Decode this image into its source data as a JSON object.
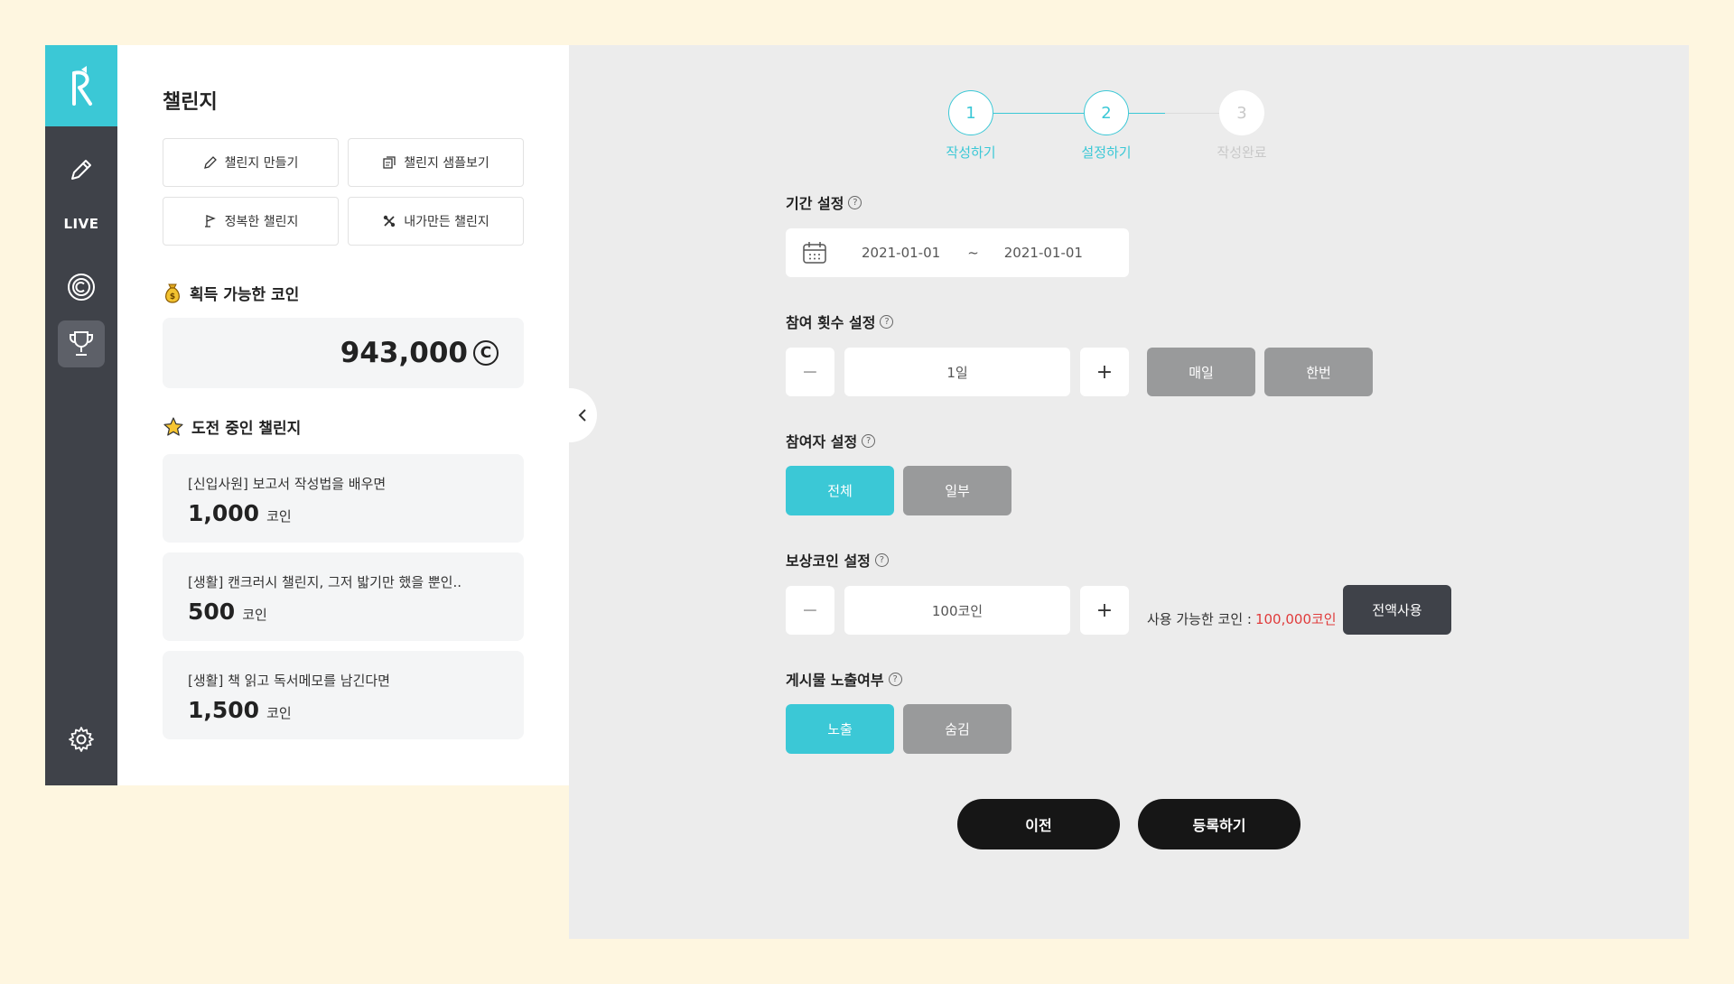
{
  "rail": {
    "live_label": "LIVE"
  },
  "panel": {
    "title": "챌린지",
    "buttons": [
      {
        "label": "챌린지 만들기",
        "icon": "pencil-icon"
      },
      {
        "label": "챌린지 샘플보기",
        "icon": "sample-icon"
      },
      {
        "label": "정복한 챌린지",
        "icon": "flag-icon"
      },
      {
        "label": "내가만든 챌린지",
        "icon": "tools-icon"
      }
    ],
    "coins_heading": "획득 가능한 코인",
    "coins_amount": "943,000",
    "coins_symbol": "C",
    "ongoing_heading": "도전 중인 챌린지",
    "challenges": [
      {
        "title": "[신입사원] 보고서 작성법을 배우면",
        "amount": "1,000",
        "unit": "코인"
      },
      {
        "title": "[생활] 캔크러시 챌린지, 그저 밟기만 했을 뿐인..",
        "amount": "500",
        "unit": "코인"
      },
      {
        "title": "[생활] 책 읽고 독서메모를 남긴다면",
        "amount": "1,500",
        "unit": "코인"
      }
    ]
  },
  "stepper": {
    "steps": [
      {
        "num": "1",
        "label": "작성하기",
        "state": "done"
      },
      {
        "num": "2",
        "label": "설정하기",
        "state": "current"
      },
      {
        "num": "3",
        "label": "작성완료",
        "state": "pending"
      }
    ]
  },
  "form": {
    "period": {
      "label": "기간 설정",
      "start": "2021-01-01",
      "separator": "~",
      "end": "2021-01-01"
    },
    "frequency": {
      "label": "참여 횟수 설정",
      "minus": "−",
      "value": "1일",
      "plus": "+",
      "opt_daily": "매일",
      "opt_once": "한번"
    },
    "participants": {
      "label": "참여자 설정",
      "opt_all": "전체",
      "opt_some": "일부"
    },
    "reward": {
      "label": "보상코인 설정",
      "minus": "−",
      "value": "100코인",
      "plus": "+",
      "avail_label": "사용 가능한 코인 :",
      "avail_value": "100,000코인",
      "use_all": "전액사용"
    },
    "exposure": {
      "label": "게시물 노출여부",
      "opt_show": "노출",
      "opt_hide": "숨김"
    },
    "prev_button": "이전",
    "submit_button": "등록하기",
    "help_mark": "?"
  },
  "colors": {
    "accent": "#3bc8d6",
    "rail": "#3f4249",
    "background": "#fef6e0",
    "warning": "#e03b3b"
  }
}
